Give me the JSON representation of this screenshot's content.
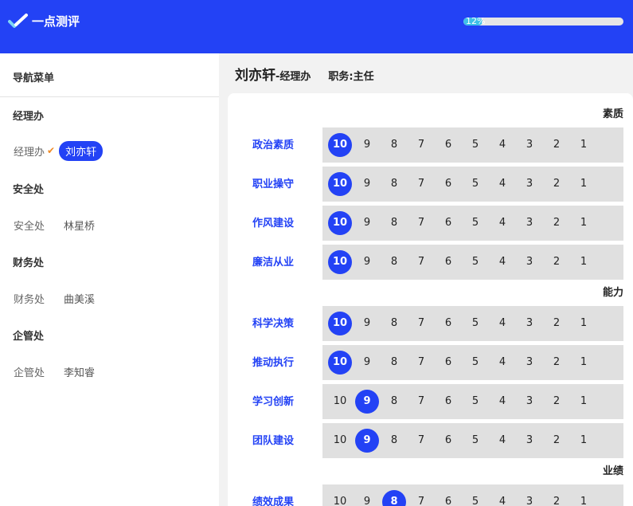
{
  "header": {
    "app_name": "一点测评",
    "progress_text": "12%",
    "progress_value": 0.12,
    "brand_color": "#2342f5",
    "progress_color": "#3fc0e8"
  },
  "sidebar": {
    "title": "导航菜单",
    "groups": [
      {
        "name": "经理办",
        "member_dept": "经理办",
        "member_name": "刘亦轩",
        "checked": true,
        "active": true
      },
      {
        "name": "安全处",
        "member_dept": "安全处",
        "member_name": "林星桥",
        "checked": false,
        "active": false
      },
      {
        "name": "财务处",
        "member_dept": "财务处",
        "member_name": "曲美溪",
        "checked": false,
        "active": false
      },
      {
        "name": "企管处",
        "member_dept": "企管处",
        "member_name": "李知睿",
        "checked": false,
        "active": false
      }
    ]
  },
  "main": {
    "person_name": "刘亦轩",
    "person_dept": "-经理办",
    "person_role": "职务:主任",
    "scale": [
      "10",
      "9",
      "8",
      "7",
      "6",
      "5",
      "4",
      "3",
      "2",
      "1"
    ],
    "categories": [
      {
        "name": "素质",
        "items": [
          {
            "label": "政治素质",
            "selected": "10"
          },
          {
            "label": "职业操守",
            "selected": "10"
          },
          {
            "label": "作风建设",
            "selected": "10"
          },
          {
            "label": "廉洁从业",
            "selected": "10"
          }
        ]
      },
      {
        "name": "能力",
        "items": [
          {
            "label": "科学决策",
            "selected": "10"
          },
          {
            "label": "推动执行",
            "selected": "10"
          },
          {
            "label": "学习创新",
            "selected": "9"
          },
          {
            "label": "团队建设",
            "selected": "9"
          }
        ]
      },
      {
        "name": "业绩",
        "items": [
          {
            "label": "绩效成果",
            "selected": "8"
          }
        ]
      }
    ]
  }
}
